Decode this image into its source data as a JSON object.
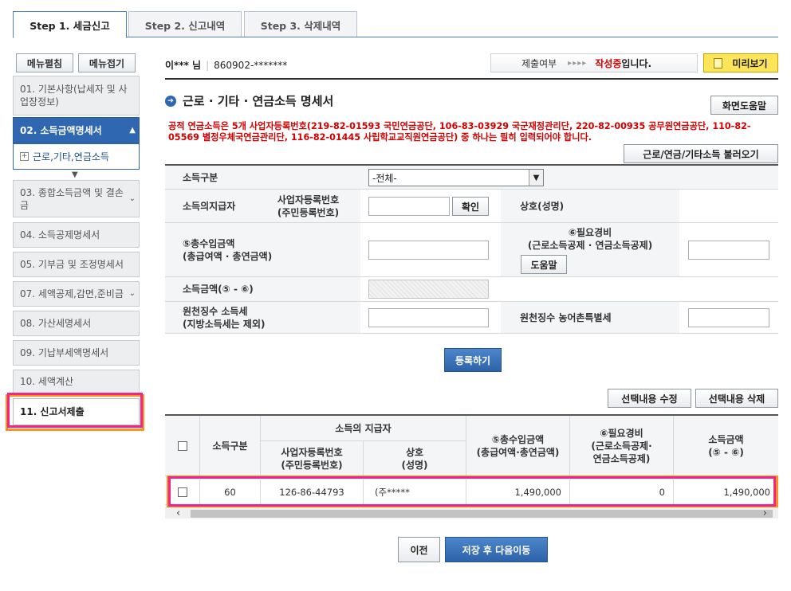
{
  "tabs": [
    {
      "label": "Step 1. 세금신고",
      "active": true
    },
    {
      "label": "Step 2. 신고내역",
      "active": false
    },
    {
      "label": "Step 3. 삭제내역",
      "active": false
    }
  ],
  "sidebar": {
    "expand_label": "메뉴펼침",
    "collapse_label": "메뉴접기",
    "items": [
      {
        "label": "01. 기본사항(납세자 및 사업장정보)"
      },
      {
        "label": "02. 소득금액명세서"
      },
      {
        "label": "03. 종합소득금액 및 결손금"
      },
      {
        "label": "04. 소득공제명세서"
      },
      {
        "label": "05. 기부금 및 조정명세서"
      },
      {
        "label": "07. 세액공제,감면,준비금"
      },
      {
        "label": "08. 가산세명세서"
      },
      {
        "label": "09. 기납부세액명세서"
      },
      {
        "label": "10. 세액계산"
      },
      {
        "label": "11. 신고서제출"
      }
    ],
    "sub_item": "근로,기타,연금소득"
  },
  "header": {
    "user_name": "이*** 님",
    "user_id": "860902-*******",
    "status_label": "제출여부",
    "status_arrows": "▸▸▸▸",
    "status_value": "작성중",
    "status_suffix": "입니다.",
    "preview_label": "미리보기"
  },
  "section": {
    "title": "근로 · 기타 · 연금소득 명세서",
    "help_button": "화면도움말",
    "notice": "공적 연금소득은 5개 사업자등록번호(219-82-01593 국민연금공단, 106-83-03929 국군재정관리단, 220-82-00935 공무원연금공단, 110-82-05569 별정우체국연금관리단, 116-82-01445 사립학교교직원연금공단) 중 하나는 필히 입력되어야 합니다.",
    "load_button": "근로/연금/기타소득 불러오기"
  },
  "form": {
    "income_type_label": "소득구분",
    "income_type_value": "-전체-",
    "payer_label": "소득의지급자",
    "biz_no_label": "사업자등록번호\n(주민등록번호)",
    "confirm_button": "확인",
    "company_label": "상호(성명)",
    "total_income_label": "⑤총수입금액\n(총급여액 · 총연금액)",
    "necessary_label": "⑥필요경비\n(근로소득공제 · 연금소득공제)",
    "help_button": "도움말",
    "income_amount_label": "소득금액(⑤ - ⑥)",
    "withholding_label": "원천징수 소득세\n(지방소득세는 제외)",
    "rural_tax_label": "원천징수 농어촌특별세",
    "register_button": "등록하기"
  },
  "table_actions": {
    "edit_button": "선택내용 수정",
    "delete_button": "선택내용 삭제"
  },
  "table": {
    "headers": {
      "type": "소득구분",
      "payer": "소득의 지급자",
      "biz_no": "사업자등록번호\n(주민등록번호)",
      "company": "상호\n(성명)",
      "total": "⑤총수입금액\n(총급여액·총연금액)",
      "necessary": "⑥필요경비\n(근로소득공제·\n연금소득공제)",
      "income": "소득금액\n(⑤ - ⑥)"
    },
    "rows": [
      {
        "type": "60",
        "biz_no": "126-86-44793",
        "company": "(주*****",
        "total": "1,490,000",
        "necessary": "0",
        "income": "1,490,000"
      }
    ]
  },
  "footer": {
    "prev_button": "이전",
    "next_button": "저장 후 다음이동"
  },
  "colors": {
    "accent": "#2f67b0",
    "highlight_pink": "#f0258a",
    "highlight_orange": "#f7931e",
    "notice_red": "#d40000",
    "preview_yellow": "#fde55a"
  }
}
